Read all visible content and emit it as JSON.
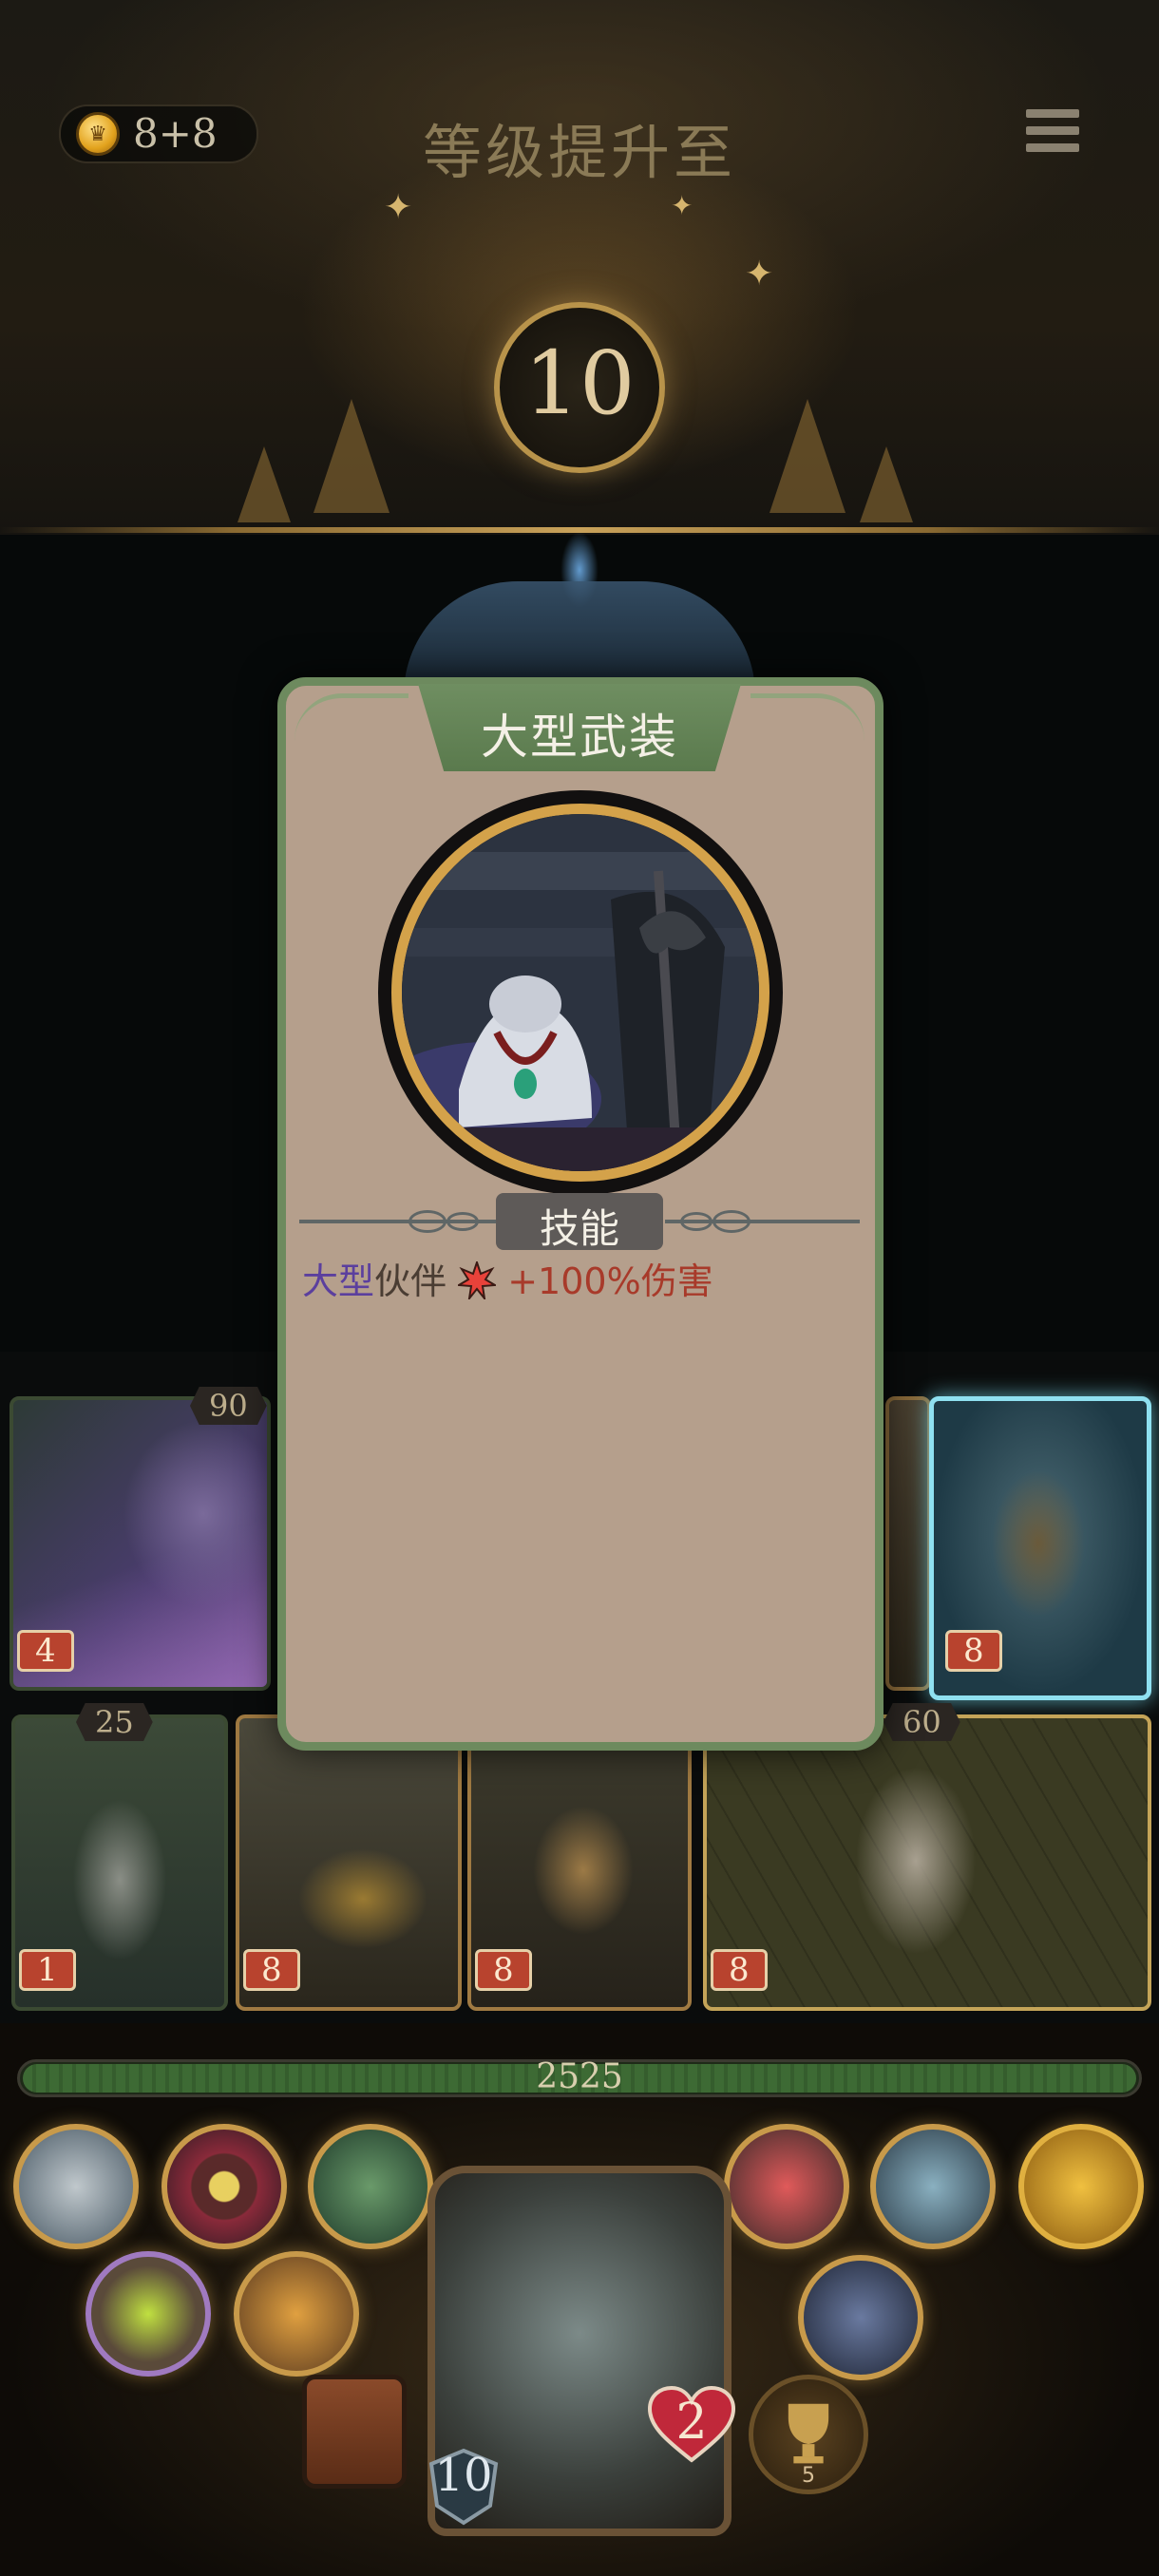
{
  "header": {
    "coins": "8+8",
    "title": "等级提升至",
    "level": "10"
  },
  "board": {
    "top_row": [
      {
        "stat": "90",
        "badge": "4"
      },
      {
        "stat": "",
        "badge": "8"
      }
    ],
    "bottom_row": [
      {
        "stat": "25",
        "badge": "1"
      },
      {
        "stat": "",
        "badge": "8"
      },
      {
        "stat": "",
        "badge": "8"
      },
      {
        "stat": "60",
        "badge": "8"
      }
    ]
  },
  "popup": {
    "title": "大型武装",
    "section_label": "技能",
    "desc_keyword": "大型",
    "desc_text": "伙伴",
    "desc_effect": "+100%伤害"
  },
  "hud": {
    "hp": "2525",
    "hero_hearts": "2",
    "hero_level": "10",
    "trophy_count": "5"
  },
  "colors": {
    "popup_bg": "#b59f8c",
    "popup_border": "#6d8a5e",
    "keyword": "#5b3f9e",
    "damage": "#a83a2a",
    "badge": "#b8432e"
  }
}
